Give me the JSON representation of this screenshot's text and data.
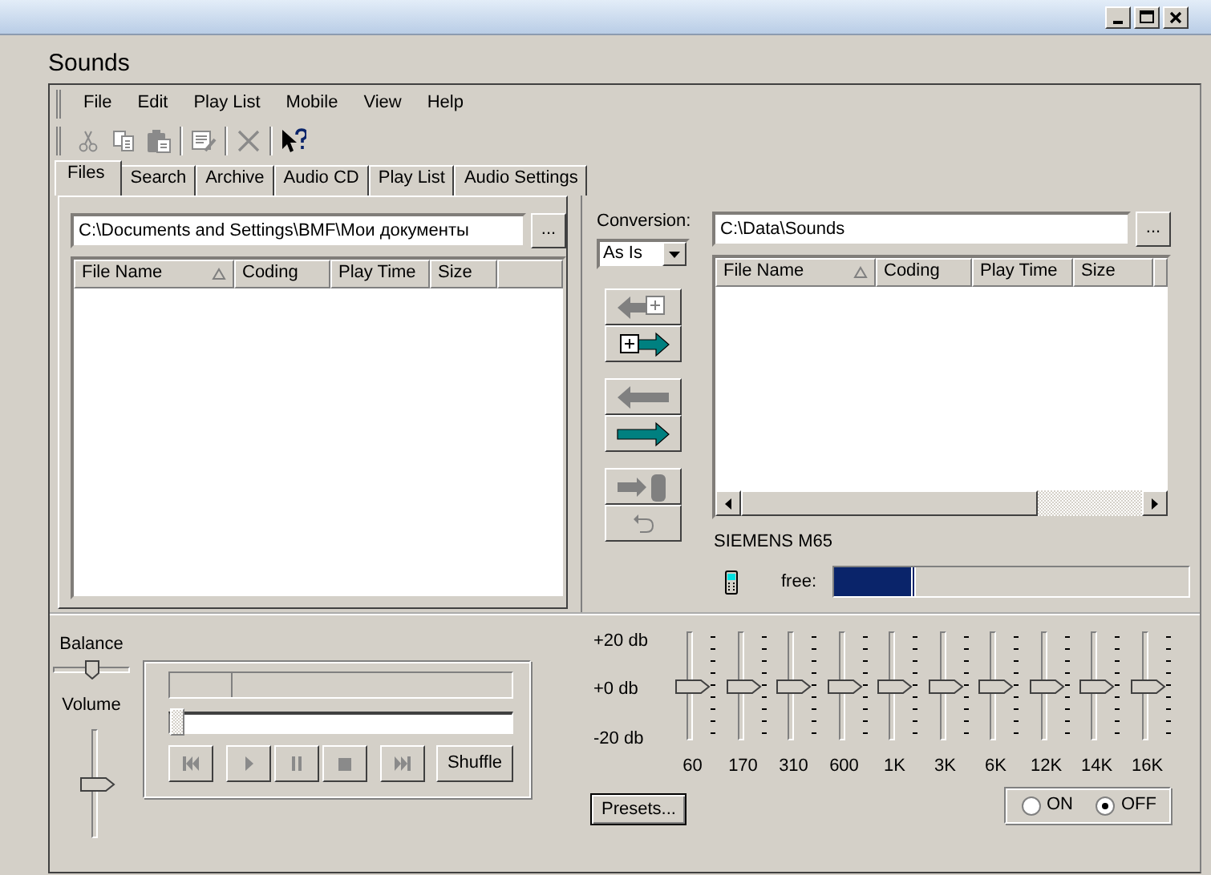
{
  "app_title": "Sounds",
  "menu": [
    "File",
    "Edit",
    "Play List",
    "Mobile",
    "View",
    "Help"
  ],
  "toolbar": [
    {
      "kind": "cut",
      "disabled": true
    },
    {
      "kind": "copy",
      "disabled": true
    },
    {
      "kind": "paste",
      "disabled": true
    },
    {
      "kind": "edit",
      "disabled": true
    },
    {
      "kind": "delete",
      "disabled": true
    },
    {
      "kind": "help",
      "disabled": false
    }
  ],
  "tabs": [
    {
      "label": "Files",
      "selected": true
    },
    {
      "label": "Search",
      "selected": false
    },
    {
      "label": "Archive",
      "selected": false
    },
    {
      "label": "Audio CD",
      "selected": false
    },
    {
      "label": "Play List",
      "selected": false
    },
    {
      "label": "Audio Settings",
      "selected": false
    }
  ],
  "local": {
    "path": "C:\\Documents and Settings\\BMF\\Мои документы",
    "browse": "...",
    "columns": [
      {
        "label": "File Name",
        "sorted": true
      },
      {
        "label": "Coding",
        "sorted": false
      },
      {
        "label": "Play Time",
        "sorted": false
      },
      {
        "label": "Size",
        "sorted": false
      }
    ]
  },
  "conversion": {
    "label": "Conversion:",
    "value": "As Is"
  },
  "transfer_buttons": [
    {
      "kind": "add-left",
      "disabled": true
    },
    {
      "kind": "add-right",
      "disabled": false
    },
    {
      "kind": "left",
      "disabled": true
    },
    {
      "kind": "right",
      "disabled": false
    },
    {
      "kind": "to-phone",
      "disabled": true
    },
    {
      "kind": "undo",
      "disabled": true
    }
  ],
  "device": {
    "path": "C:\\Data\\Sounds",
    "browse": "...",
    "columns": [
      {
        "label": "File Name",
        "sorted": true
      },
      {
        "label": "Coding",
        "sorted": false
      },
      {
        "label": "Play Time",
        "sorted": false
      },
      {
        "label": "Size",
        "sorted": false
      }
    ],
    "name": "SIEMENS M65",
    "free_label": "free:",
    "free": {
      "level": 0.23
    }
  },
  "player": {
    "balance": {
      "label": "Balance",
      "level": 0.5
    },
    "volume": {
      "label": "Volume",
      "level": 0.5
    },
    "position": {
      "level": 0
    },
    "buttons": [
      {
        "kind": "previous",
        "disabled": true
      },
      {
        "kind": "play",
        "disabled": true
      },
      {
        "kind": "pause",
        "disabled": true
      },
      {
        "kind": "stop",
        "disabled": true
      },
      {
        "kind": "next",
        "disabled": true
      },
      {
        "kind": "text",
        "label": "Shuffle",
        "disabled": false
      }
    ]
  },
  "equalizer": {
    "scale": [
      "+20 db",
      "+0 db",
      "-20 db"
    ],
    "bands": [
      {
        "label": "60",
        "level": 0.5
      },
      {
        "label": "170",
        "level": 0.5
      },
      {
        "label": "310",
        "level": 0.5
      },
      {
        "label": "600",
        "level": 0.5
      },
      {
        "label": "1K",
        "level": 0.5
      },
      {
        "label": "3K",
        "level": 0.5
      },
      {
        "label": "6K",
        "level": 0.5
      },
      {
        "label": "12K",
        "level": 0.5
      },
      {
        "label": "14K",
        "level": 0.5
      },
      {
        "label": "16K",
        "level": 0.5
      }
    ],
    "presets": "Presets...",
    "modes": [
      {
        "label": "ON",
        "selected": false
      },
      {
        "label": "OFF",
        "selected": true
      }
    ]
  }
}
